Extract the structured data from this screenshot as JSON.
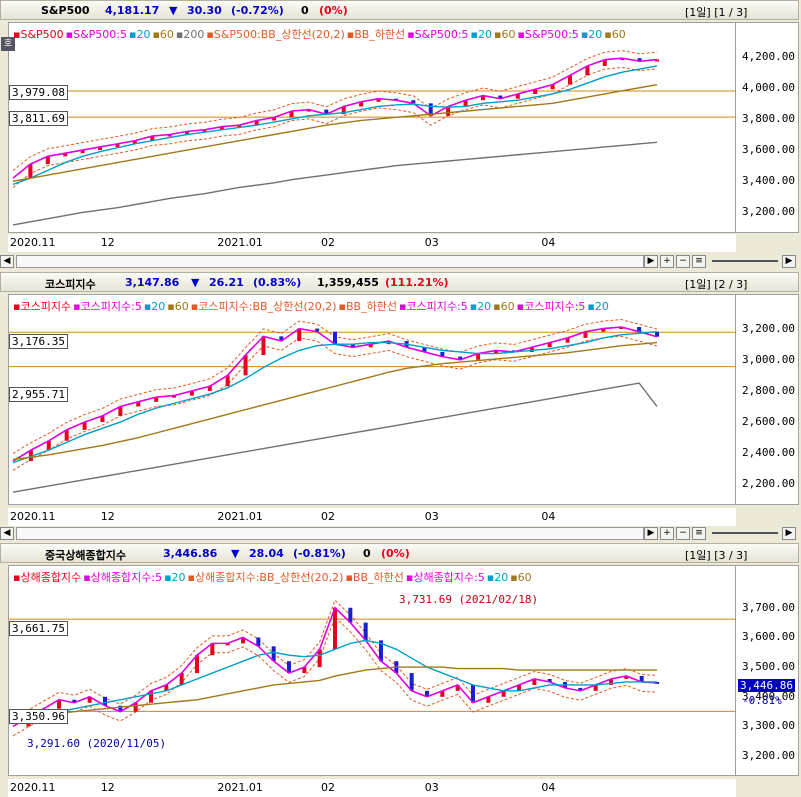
{
  "panels": [
    {
      "header": {
        "name": "S&P500",
        "price": "4,181.17",
        "arrow": "▼",
        "change": "30.30",
        "change_pct": "(-0.72%)",
        "volume": "0",
        "volume_pct": "(0%)",
        "tag": "[1일] [1 / 3]"
      },
      "badge": "호",
      "legend": [
        [
          "S&P500",
          "#e8001c"
        ],
        [
          "S&P500:5",
          "#e000e0"
        ],
        [
          "20",
          "#009ec8"
        ],
        [
          "60",
          "#a07818"
        ],
        [
          "200",
          "#707070"
        ],
        [
          "S&P500:BB_상한선(20,2)",
          "#e05a28"
        ],
        [
          "BB_하한선",
          "#e05a28"
        ],
        [
          "S&P500:5",
          "#e000e0"
        ],
        [
          "20",
          "#009ec8"
        ],
        [
          "60",
          "#a07818"
        ],
        [
          "S&P500:5",
          "#e000e0"
        ],
        [
          "20",
          "#009ec8"
        ],
        [
          "60",
          "#a07818"
        ]
      ],
      "y_ticks": [
        "4,200.00",
        "4,000.00",
        "3,800.00",
        "3,600.00",
        "3,400.00",
        "3,200.00"
      ],
      "x_ticks": [
        "2020.11",
        "12",
        "2021.01",
        "02",
        "03",
        "04"
      ],
      "hlines": [
        {
          "label": "3,979.08",
          "value": 3979.08
        },
        {
          "label": "3,811.69",
          "value": 3811.69
        }
      ]
    },
    {
      "header": {
        "name": "코스피지수",
        "price": "3,147.86",
        "arrow": "▼",
        "change": "26.21",
        "change_pct": "(0.83%)",
        "volume": "1,359,455",
        "volume_pct": "(111.21%)",
        "tag": "[1일] [2 / 3]"
      },
      "legend": [
        [
          "코스피지수",
          "#e8001c"
        ],
        [
          "코스피지수:5",
          "#e000e0"
        ],
        [
          "20",
          "#009ec8"
        ],
        [
          "60",
          "#a07818"
        ],
        [
          "코스피지수:BB_상한선(20,2)",
          "#e05a28"
        ],
        [
          "BB_하한선",
          "#e05a28"
        ],
        [
          "코스피지수:5",
          "#e000e0"
        ],
        [
          "20",
          "#009ec8"
        ],
        [
          "60",
          "#a07818"
        ],
        [
          "코스피지수:5",
          "#e000e0"
        ],
        [
          "20",
          "#009ec8"
        ]
      ],
      "y_ticks": [
        "3,200.00",
        "3,000.00",
        "2,800.00",
        "2,600.00",
        "2,400.00",
        "2,200.00"
      ],
      "x_ticks": [
        "2020.11",
        "12",
        "2021.01",
        "02",
        "03",
        "04"
      ],
      "hlines": [
        {
          "label": "3,176.35",
          "value": 3176.35
        },
        {
          "label": "2,955.71",
          "value": 2955.71
        }
      ]
    },
    {
      "header": {
        "name": "중국상해종합지수",
        "price": "3,446.86",
        "arrow": "▼",
        "change": "28.04",
        "change_pct": "(-0.81%)",
        "volume": "0",
        "volume_pct": "(0%)",
        "tag": "[1일] [3 / 3]"
      },
      "legend": [
        [
          "상해종합지수",
          "#e8001c"
        ],
        [
          "상해종합지수:5",
          "#e000e0"
        ],
        [
          "20",
          "#009ec8"
        ],
        [
          "상해종합지수:BB_상한선(20,2)",
          "#e05a28"
        ],
        [
          "BB_하한선",
          "#e05a28"
        ],
        [
          "상해종합지수:5",
          "#e000e0"
        ],
        [
          "20",
          "#009ec8"
        ],
        [
          "60",
          "#a07818"
        ]
      ],
      "y_ticks": [
        "3,700.00",
        "3,600.00",
        "3,500.00",
        "3,400.00",
        "3,300.00",
        "3,200.00"
      ],
      "x_ticks": [
        "2020.11",
        "12",
        "2021.01",
        "02",
        "03",
        "04"
      ],
      "hlines": [
        {
          "label": "3,661.75",
          "value": 3661.75
        },
        {
          "label": "3,350.96",
          "value": 3350.96
        }
      ],
      "annotations": [
        {
          "text": "3,731.69 (2021/02/18)",
          "value": 3731.69
        },
        {
          "text": "3,291.60 (2020/11/05)",
          "value": 3291.6
        }
      ],
      "last_price": "3,446.86",
      "last_pct": "-0.81%"
    }
  ],
  "colors": {
    "up": "#e8001c",
    "down": "#1820d0",
    "ma5": "#e000e0",
    "ma20": "#009ec8",
    "ma60": "#a07818",
    "ma200": "#707070",
    "bb": "#e05a28",
    "hline": "#d08818",
    "price_up": "#0000ff"
  },
  "chart_data": [
    {
      "type": "line",
      "title": "S&P500",
      "ylim": [
        3100,
        4300
      ],
      "series": [
        {
          "name": "S&P500",
          "values": [
            3420,
            3510,
            3560,
            3580,
            3600,
            3620,
            3640,
            3660,
            3690,
            3700,
            3720,
            3730,
            3750,
            3760,
            3790,
            3810,
            3850,
            3860,
            3830,
            3880,
            3910,
            3930,
            3920,
            3900,
            3820,
            3880,
            3920,
            3950,
            3930,
            3960,
            3990,
            4020,
            4080,
            4140,
            4180,
            4190,
            4170,
            4181.17
          ]
        },
        {
          "name": "20",
          "values": [
            3380,
            3420,
            3470,
            3520,
            3560,
            3590,
            3615,
            3640,
            3660,
            3680,
            3700,
            3715,
            3730,
            3745,
            3760,
            3780,
            3800,
            3820,
            3830,
            3840,
            3860,
            3880,
            3890,
            3895,
            3880,
            3875,
            3880,
            3900,
            3910,
            3920,
            3940,
            3960,
            3990,
            4030,
            4070,
            4100,
            4120,
            4140
          ]
        },
        {
          "name": "60",
          "values": [
            3400,
            3420,
            3440,
            3460,
            3480,
            3500,
            3520,
            3540,
            3560,
            3580,
            3600,
            3620,
            3640,
            3660,
            3680,
            3700,
            3720,
            3740,
            3760,
            3775,
            3790,
            3800,
            3810,
            3820,
            3830,
            3840,
            3850,
            3860,
            3870,
            3880,
            3890,
            3900,
            3920,
            3940,
            3960,
            3980,
            4000,
            4020
          ]
        },
        {
          "name": "200",
          "values": [
            3120,
            3140,
            3160,
            3180,
            3200,
            3215,
            3230,
            3250,
            3270,
            3290,
            3305,
            3320,
            3340,
            3360,
            3375,
            3390,
            3410,
            3425,
            3440,
            3455,
            3470,
            3485,
            3500,
            3510,
            3520,
            3530,
            3540,
            3550,
            3560,
            3570,
            3580,
            3590,
            3600,
            3610,
            3620,
            3630,
            3640,
            3650
          ]
        }
      ]
    },
    {
      "type": "line",
      "title": "코스피지수",
      "ylim": [
        2100,
        3300
      ],
      "series": [
        {
          "name": "코스피지수",
          "values": [
            2350,
            2420,
            2480,
            2550,
            2600,
            2640,
            2700,
            2730,
            2760,
            2770,
            2800,
            2830,
            2900,
            3030,
            3150,
            3120,
            3200,
            3180,
            3100,
            3080,
            3100,
            3120,
            3080,
            3050,
            3020,
            3000,
            3040,
            3060,
            3050,
            3080,
            3110,
            3140,
            3180,
            3200,
            3210,
            3180,
            3147.86
          ]
        },
        {
          "name": "20",
          "values": [
            2340,
            2380,
            2420,
            2470,
            2520,
            2560,
            2600,
            2650,
            2690,
            2720,
            2750,
            2780,
            2820,
            2880,
            2950,
            3010,
            3060,
            3090,
            3100,
            3100,
            3110,
            3110,
            3100,
            3080,
            3060,
            3050,
            3040,
            3040,
            3050,
            3060,
            3070,
            3090,
            3110,
            3140,
            3160,
            3170,
            3180
          ]
        },
        {
          "name": "60",
          "values": [
            2360,
            2375,
            2390,
            2410,
            2430,
            2450,
            2475,
            2500,
            2530,
            2560,
            2590,
            2620,
            2650,
            2680,
            2710,
            2740,
            2770,
            2800,
            2830,
            2860,
            2890,
            2920,
            2945,
            2960,
            2975,
            2985,
            2995,
            3005,
            3015,
            3025,
            3035,
            3045,
            3060,
            3075,
            3090,
            3100,
            3110
          ]
        },
        {
          "name": "200",
          "values": [
            2150,
            2170,
            2190,
            2210,
            2230,
            2250,
            2270,
            2290,
            2310,
            2330,
            2350,
            2370,
            2390,
            2410,
            2430,
            2450,
            2470,
            2490,
            2510,
            2530,
            2550,
            2570,
            2590,
            2610,
            2630,
            2650,
            2670,
            2690,
            2710,
            2730,
            2750,
            2770,
            2790,
            2810,
            2830,
            2850,
            2700
          ]
        }
      ]
    },
    {
      "type": "line",
      "title": "중국상해종합지수",
      "ylim": [
        3150,
        3780
      ],
      "series": [
        {
          "name": "상해종합지수",
          "values": [
            3300,
            3330,
            3360,
            3390,
            3380,
            3400,
            3370,
            3350,
            3380,
            3420,
            3440,
            3480,
            3540,
            3580,
            3580,
            3600,
            3570,
            3520,
            3480,
            3500,
            3560,
            3700,
            3650,
            3590,
            3520,
            3480,
            3420,
            3400,
            3420,
            3440,
            3380,
            3400,
            3420,
            3440,
            3460,
            3450,
            3430,
            3420,
            3440,
            3460,
            3470,
            3450,
            3446.86
          ]
        },
        {
          "name": "20",
          "values": [
            3320,
            3330,
            3340,
            3350,
            3360,
            3370,
            3380,
            3390,
            3400,
            3410,
            3420,
            3440,
            3460,
            3480,
            3500,
            3520,
            3540,
            3550,
            3540,
            3535,
            3540,
            3560,
            3580,
            3590,
            3580,
            3560,
            3530,
            3500,
            3480,
            3460,
            3440,
            3430,
            3420,
            3420,
            3430,
            3440,
            3440,
            3440,
            3440,
            3445,
            3450,
            3450,
            3450
          ]
        },
        {
          "name": "60",
          "values": [
            3330,
            3335,
            3340,
            3345,
            3350,
            3355,
            3360,
            3365,
            3370,
            3375,
            3380,
            3385,
            3390,
            3400,
            3410,
            3420,
            3430,
            3440,
            3445,
            3450,
            3455,
            3470,
            3480,
            3490,
            3495,
            3500,
            3500,
            3500,
            3500,
            3495,
            3495,
            3495,
            3495,
            3490,
            3490,
            3490,
            3490,
            3490,
            3490,
            3490,
            3490,
            3490,
            3490
          ]
        }
      ]
    }
  ]
}
